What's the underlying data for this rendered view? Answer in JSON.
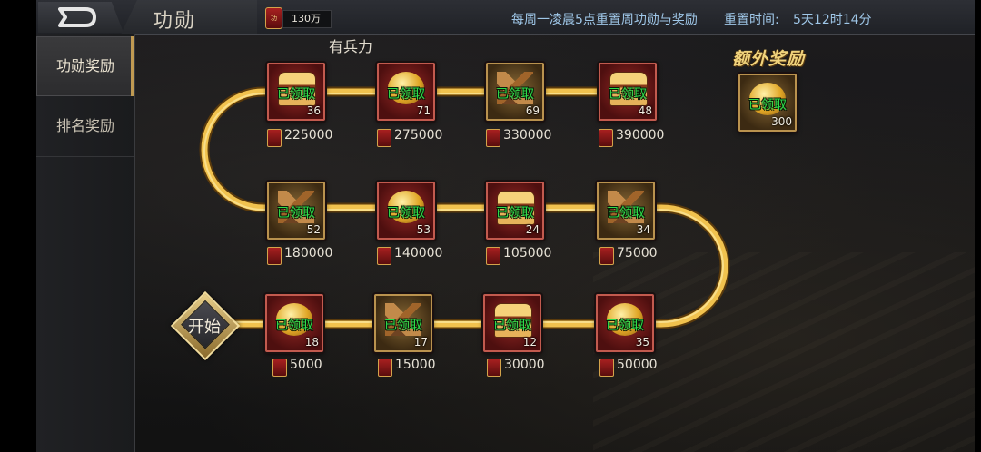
{
  "header": {
    "title": "功勋",
    "merit_badge_text": "功",
    "merit_value": "130万",
    "reset_note": "每周一凌晨5点重置周功勋与奖励",
    "reset_label": "重置时间:",
    "reset_time": "5天12时14分"
  },
  "sidebar": {
    "items": [
      {
        "label": "功勋奖励",
        "active": true
      },
      {
        "label": "排名奖励",
        "active": false
      }
    ]
  },
  "main": {
    "subtitle": "有兵力",
    "start_label": "开始",
    "extra_reward_title": "额外奖励",
    "claimed_text": "已领取",
    "rows": [
      [
        {
          "icon": "treasure-chest",
          "qty": "36",
          "req": "225000"
        },
        {
          "icon": "gold-coins",
          "qty": "71",
          "req": "275000"
        },
        {
          "icon": "construction-hammer",
          "qty": "69",
          "req": "330000"
        },
        {
          "icon": "treasure-chest",
          "qty": "48",
          "req": "390000"
        }
      ],
      [
        {
          "icon": "construction-hammer",
          "qty": "52",
          "req": "180000"
        },
        {
          "icon": "gold-coins",
          "qty": "53",
          "req": "140000"
        },
        {
          "icon": "treasure-chest",
          "qty": "24",
          "req": "105000"
        },
        {
          "icon": "construction-hammer",
          "qty": "34",
          "req": "75000"
        }
      ],
      [
        {
          "icon": "gold-coins",
          "qty": "18",
          "req": "5000"
        },
        {
          "icon": "construction-hammer",
          "qty": "17",
          "req": "15000"
        },
        {
          "icon": "treasure-chest",
          "qty": "12",
          "req": "30000"
        },
        {
          "icon": "gold-coins",
          "qty": "35",
          "req": "50000"
        }
      ]
    ],
    "extra_reward": {
      "icon": "gold-coins",
      "qty": "300"
    }
  }
}
